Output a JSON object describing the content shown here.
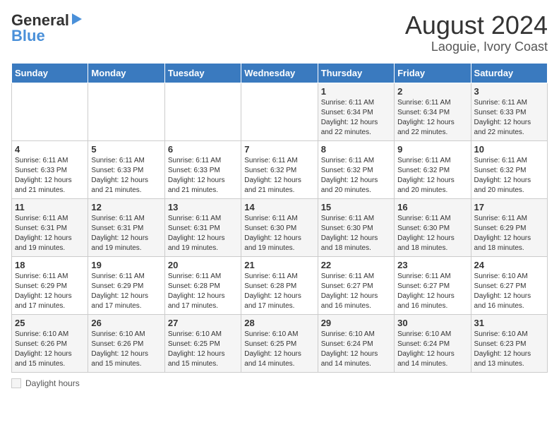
{
  "header": {
    "logo_general": "General",
    "logo_blue": "Blue",
    "title": "August 2024",
    "subtitle": "Laoguie, Ivory Coast"
  },
  "footer": {
    "legend_label": "Daylight hours"
  },
  "calendar": {
    "weekdays": [
      "Sunday",
      "Monday",
      "Tuesday",
      "Wednesday",
      "Thursday",
      "Friday",
      "Saturday"
    ],
    "weeks": [
      [
        {
          "day": "",
          "info": ""
        },
        {
          "day": "",
          "info": ""
        },
        {
          "day": "",
          "info": ""
        },
        {
          "day": "",
          "info": ""
        },
        {
          "day": "1",
          "info": "Sunrise: 6:11 AM\nSunset: 6:34 PM\nDaylight: 12 hours\nand 22 minutes."
        },
        {
          "day": "2",
          "info": "Sunrise: 6:11 AM\nSunset: 6:34 PM\nDaylight: 12 hours\nand 22 minutes."
        },
        {
          "day": "3",
          "info": "Sunrise: 6:11 AM\nSunset: 6:33 PM\nDaylight: 12 hours\nand 22 minutes."
        }
      ],
      [
        {
          "day": "4",
          "info": "Sunrise: 6:11 AM\nSunset: 6:33 PM\nDaylight: 12 hours\nand 21 minutes."
        },
        {
          "day": "5",
          "info": "Sunrise: 6:11 AM\nSunset: 6:33 PM\nDaylight: 12 hours\nand 21 minutes."
        },
        {
          "day": "6",
          "info": "Sunrise: 6:11 AM\nSunset: 6:33 PM\nDaylight: 12 hours\nand 21 minutes."
        },
        {
          "day": "7",
          "info": "Sunrise: 6:11 AM\nSunset: 6:32 PM\nDaylight: 12 hours\nand 21 minutes."
        },
        {
          "day": "8",
          "info": "Sunrise: 6:11 AM\nSunset: 6:32 PM\nDaylight: 12 hours\nand 20 minutes."
        },
        {
          "day": "9",
          "info": "Sunrise: 6:11 AM\nSunset: 6:32 PM\nDaylight: 12 hours\nand 20 minutes."
        },
        {
          "day": "10",
          "info": "Sunrise: 6:11 AM\nSunset: 6:32 PM\nDaylight: 12 hours\nand 20 minutes."
        }
      ],
      [
        {
          "day": "11",
          "info": "Sunrise: 6:11 AM\nSunset: 6:31 PM\nDaylight: 12 hours\nand 19 minutes."
        },
        {
          "day": "12",
          "info": "Sunrise: 6:11 AM\nSunset: 6:31 PM\nDaylight: 12 hours\nand 19 minutes."
        },
        {
          "day": "13",
          "info": "Sunrise: 6:11 AM\nSunset: 6:31 PM\nDaylight: 12 hours\nand 19 minutes."
        },
        {
          "day": "14",
          "info": "Sunrise: 6:11 AM\nSunset: 6:30 PM\nDaylight: 12 hours\nand 19 minutes."
        },
        {
          "day": "15",
          "info": "Sunrise: 6:11 AM\nSunset: 6:30 PM\nDaylight: 12 hours\nand 18 minutes."
        },
        {
          "day": "16",
          "info": "Sunrise: 6:11 AM\nSunset: 6:30 PM\nDaylight: 12 hours\nand 18 minutes."
        },
        {
          "day": "17",
          "info": "Sunrise: 6:11 AM\nSunset: 6:29 PM\nDaylight: 12 hours\nand 18 minutes."
        }
      ],
      [
        {
          "day": "18",
          "info": "Sunrise: 6:11 AM\nSunset: 6:29 PM\nDaylight: 12 hours\nand 17 minutes."
        },
        {
          "day": "19",
          "info": "Sunrise: 6:11 AM\nSunset: 6:29 PM\nDaylight: 12 hours\nand 17 minutes."
        },
        {
          "day": "20",
          "info": "Sunrise: 6:11 AM\nSunset: 6:28 PM\nDaylight: 12 hours\nand 17 minutes."
        },
        {
          "day": "21",
          "info": "Sunrise: 6:11 AM\nSunset: 6:28 PM\nDaylight: 12 hours\nand 17 minutes."
        },
        {
          "day": "22",
          "info": "Sunrise: 6:11 AM\nSunset: 6:27 PM\nDaylight: 12 hours\nand 16 minutes."
        },
        {
          "day": "23",
          "info": "Sunrise: 6:11 AM\nSunset: 6:27 PM\nDaylight: 12 hours\nand 16 minutes."
        },
        {
          "day": "24",
          "info": "Sunrise: 6:10 AM\nSunset: 6:27 PM\nDaylight: 12 hours\nand 16 minutes."
        }
      ],
      [
        {
          "day": "25",
          "info": "Sunrise: 6:10 AM\nSunset: 6:26 PM\nDaylight: 12 hours\nand 15 minutes."
        },
        {
          "day": "26",
          "info": "Sunrise: 6:10 AM\nSunset: 6:26 PM\nDaylight: 12 hours\nand 15 minutes."
        },
        {
          "day": "27",
          "info": "Sunrise: 6:10 AM\nSunset: 6:25 PM\nDaylight: 12 hours\nand 15 minutes."
        },
        {
          "day": "28",
          "info": "Sunrise: 6:10 AM\nSunset: 6:25 PM\nDaylight: 12 hours\nand 14 minutes."
        },
        {
          "day": "29",
          "info": "Sunrise: 6:10 AM\nSunset: 6:24 PM\nDaylight: 12 hours\nand 14 minutes."
        },
        {
          "day": "30",
          "info": "Sunrise: 6:10 AM\nSunset: 6:24 PM\nDaylight: 12 hours\nand 14 minutes."
        },
        {
          "day": "31",
          "info": "Sunrise: 6:10 AM\nSunset: 6:23 PM\nDaylight: 12 hours\nand 13 minutes."
        }
      ]
    ]
  }
}
